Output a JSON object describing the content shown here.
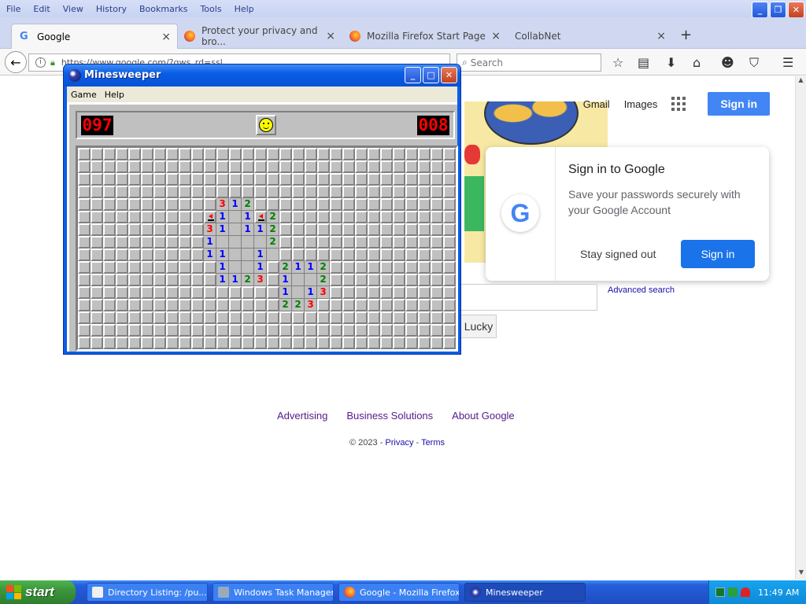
{
  "firefox": {
    "menu": [
      "File",
      "Edit",
      "View",
      "History",
      "Bookmarks",
      "Tools",
      "Help"
    ],
    "tabs": [
      {
        "label": "Google"
      },
      {
        "label": "Protect your privacy and bro..."
      },
      {
        "label": "Mozilla Firefox Start Page"
      },
      {
        "label": "CollabNet"
      }
    ],
    "url": "https://www.google.com/?gws_rd=ssl",
    "search_placeholder": "Search"
  },
  "google": {
    "top_links": {
      "gmail": "Gmail",
      "images": "Images",
      "signin": "Sign in"
    },
    "card": {
      "title": "Sign in to Google",
      "desc": "Save your passwords securely with your Google Account",
      "stay": "Stay signed out",
      "signin": "Sign in"
    },
    "advanced_search": "Advanced search",
    "lucky": "Lucky",
    "footer": {
      "advertising": "Advertising",
      "business": "Business Solutions",
      "about": "About Google"
    },
    "copyright": "© 2023 - ",
    "privacy": "Privacy",
    "sep": " - ",
    "terms": "Terms"
  },
  "minesweeper": {
    "title": "Minesweeper",
    "menu": {
      "game": "Game",
      "help": "Help"
    },
    "mines_left": "097",
    "timer": "008",
    "cols": 30,
    "rows": 16,
    "opened": [
      [
        4,
        11,
        "3"
      ],
      [
        4,
        12,
        "1"
      ],
      [
        4,
        13,
        "2"
      ],
      [
        5,
        10,
        "F"
      ],
      [
        5,
        11,
        "1"
      ],
      [
        5,
        12,
        ""
      ],
      [
        5,
        13,
        "1"
      ],
      [
        5,
        14,
        "F"
      ],
      [
        5,
        15,
        "2"
      ],
      [
        6,
        10,
        "3"
      ],
      [
        6,
        11,
        "1"
      ],
      [
        6,
        12,
        ""
      ],
      [
        6,
        13,
        "1"
      ],
      [
        6,
        14,
        "1"
      ],
      [
        6,
        15,
        "2"
      ],
      [
        7,
        10,
        "1"
      ],
      [
        7,
        11,
        ""
      ],
      [
        7,
        12,
        ""
      ],
      [
        7,
        13,
        ""
      ],
      [
        7,
        14,
        ""
      ],
      [
        7,
        15,
        "2"
      ],
      [
        8,
        10,
        "1"
      ],
      [
        8,
        11,
        "1"
      ],
      [
        8,
        12,
        ""
      ],
      [
        8,
        13,
        ""
      ],
      [
        8,
        14,
        "1"
      ],
      [
        8,
        15,
        ""
      ],
      [
        9,
        11,
        "1"
      ],
      [
        9,
        12,
        ""
      ],
      [
        9,
        13,
        ""
      ],
      [
        9,
        14,
        "1"
      ],
      [
        9,
        16,
        "2"
      ],
      [
        9,
        17,
        "1"
      ],
      [
        9,
        18,
        "1"
      ],
      [
        9,
        19,
        "2"
      ],
      [
        10,
        11,
        "1"
      ],
      [
        10,
        12,
        "1"
      ],
      [
        10,
        13,
        "2"
      ],
      [
        10,
        14,
        "3"
      ],
      [
        10,
        16,
        "1"
      ],
      [
        10,
        17,
        ""
      ],
      [
        10,
        18,
        ""
      ],
      [
        10,
        19,
        "2"
      ],
      [
        11,
        16,
        "1"
      ],
      [
        11,
        17,
        ""
      ],
      [
        11,
        18,
        "1"
      ],
      [
        11,
        19,
        "3"
      ],
      [
        12,
        16,
        "2"
      ],
      [
        12,
        17,
        "2"
      ],
      [
        12,
        18,
        "3"
      ]
    ]
  },
  "taskbar": {
    "start": "start",
    "tasks": [
      {
        "label": "Directory Listing: /pu..."
      },
      {
        "label": "Windows Task Manager"
      },
      {
        "label": "Google - Mozilla Firefox"
      },
      {
        "label": "Minesweeper"
      }
    ],
    "clock": "11:49 AM"
  }
}
